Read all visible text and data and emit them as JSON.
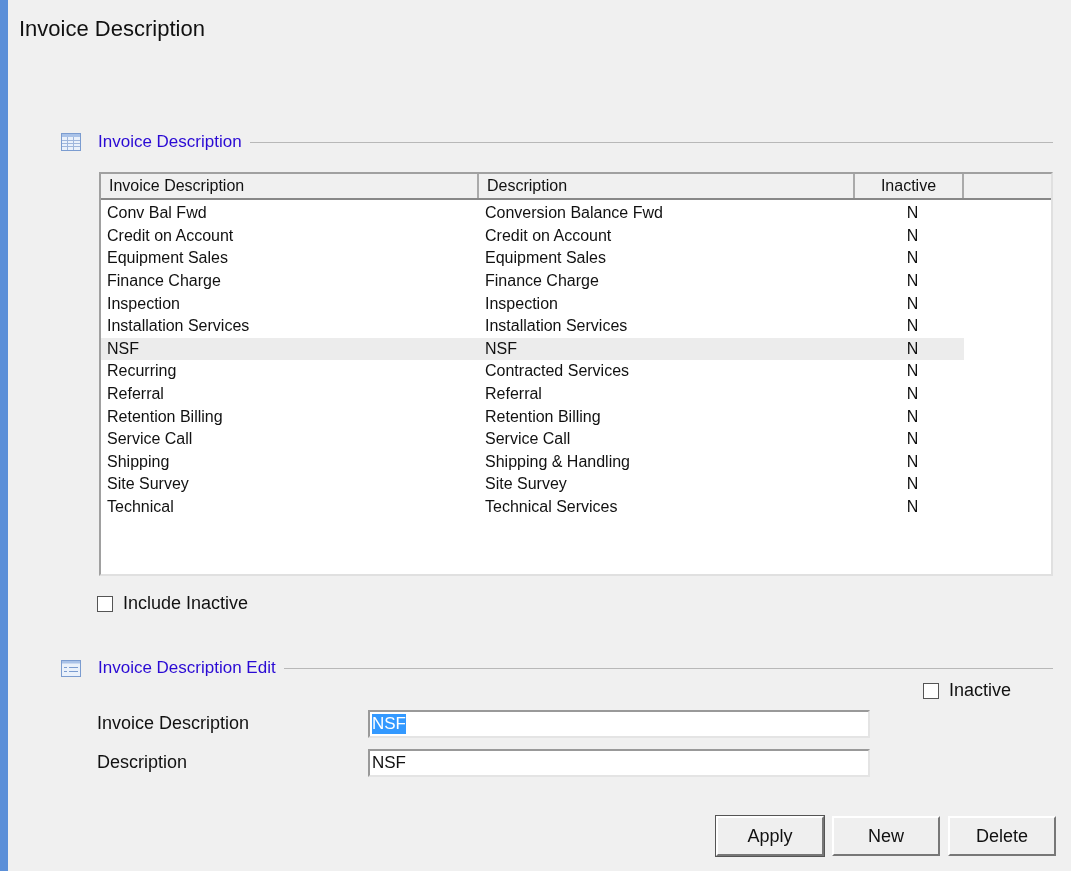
{
  "page": {
    "title": "Invoice Description"
  },
  "list_section": {
    "title": "Invoice Description",
    "table": {
      "columns": [
        "Invoice Description",
        "Description",
        "Inactive"
      ],
      "rows": [
        {
          "code": "Conv Bal Fwd",
          "description": "Conversion Balance Fwd",
          "inactive": "N",
          "selected": false
        },
        {
          "code": "Credit on Account",
          "description": "Credit on Account",
          "inactive": "N",
          "selected": false
        },
        {
          "code": "Equipment Sales",
          "description": "Equipment Sales",
          "inactive": "N",
          "selected": false
        },
        {
          "code": "Finance Charge",
          "description": "Finance Charge",
          "inactive": "N",
          "selected": false
        },
        {
          "code": "Inspection",
          "description": "Inspection",
          "inactive": "N",
          "selected": false
        },
        {
          "code": "Installation Services",
          "description": "Installation Services",
          "inactive": "N",
          "selected": false
        },
        {
          "code": "NSF",
          "description": "NSF",
          "inactive": "N",
          "selected": true
        },
        {
          "code": "Recurring",
          "description": "Contracted Services",
          "inactive": "N",
          "selected": false
        },
        {
          "code": "Referral",
          "description": "Referral",
          "inactive": "N",
          "selected": false
        },
        {
          "code": "Retention Billing",
          "description": "Retention Billing",
          "inactive": "N",
          "selected": false
        },
        {
          "code": "Service Call",
          "description": "Service Call",
          "inactive": "N",
          "selected": false
        },
        {
          "code": "Shipping",
          "description": "Shipping & Handling",
          "inactive": "N",
          "selected": false
        },
        {
          "code": "Site Survey",
          "description": "Site Survey",
          "inactive": "N",
          "selected": false
        },
        {
          "code": "Technical",
          "description": "Technical Services",
          "inactive": "N",
          "selected": false
        }
      ]
    },
    "include_inactive": {
      "label": "Include Inactive",
      "checked": false
    }
  },
  "edit_section": {
    "title": "Invoice Description Edit",
    "inactive": {
      "label": "Inactive",
      "checked": false
    },
    "fields": [
      {
        "label": "Invoice Description",
        "value": "NSF",
        "text_selected": true
      },
      {
        "label": "Description",
        "value": "NSF",
        "text_selected": false
      }
    ]
  },
  "buttons": [
    {
      "label": "Apply",
      "default": true
    },
    {
      "label": "New",
      "default": false
    },
    {
      "label": "Delete",
      "default": false
    }
  ]
}
